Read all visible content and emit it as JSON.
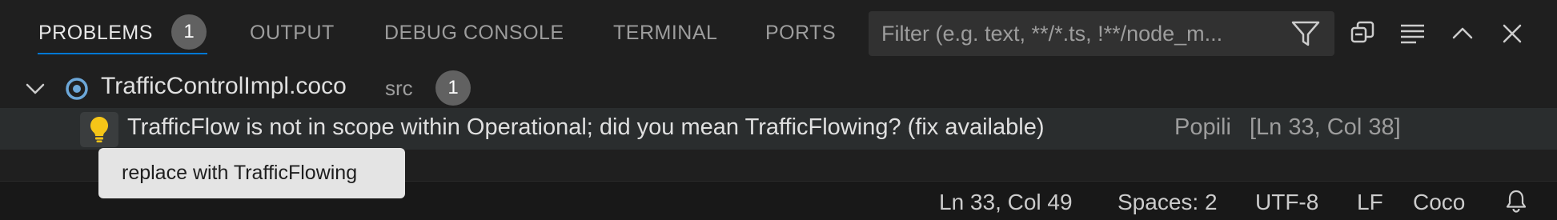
{
  "panel": {
    "tabs": [
      {
        "label": "PROBLEMS",
        "badge": "1",
        "active": true
      },
      {
        "label": "OUTPUT"
      },
      {
        "label": "DEBUG CONSOLE"
      },
      {
        "label": "TERMINAL"
      },
      {
        "label": "PORTS"
      }
    ],
    "filter": {
      "placeholder": "Filter (e.g. text, **/*.ts, !**/node_m...",
      "value": ""
    },
    "actions": [
      "filter-icon",
      "copy-icon",
      "collapse-all-icon",
      "maximize-icon",
      "close-icon"
    ]
  },
  "problems": {
    "file": {
      "name": "TrafficControlImpl.coco",
      "path": "src",
      "count": "1"
    },
    "items": [
      {
        "message": "TrafficFlow is not in scope within Operational; did you mean TrafficFlowing? (fix available)",
        "source": "Popili",
        "location": "[Ln 33, Col 38]"
      }
    ],
    "quick_fix_tooltip": "replace with TrafficFlowing"
  },
  "statusbar": {
    "cursor": "Ln 33, Col 49",
    "indent": "Spaces: 2",
    "encoding": "UTF-8",
    "eol": "LF",
    "language": "Coco"
  },
  "colors": {
    "accent": "#0078d4",
    "bulb": "#f5c518",
    "badge": "#616161"
  }
}
